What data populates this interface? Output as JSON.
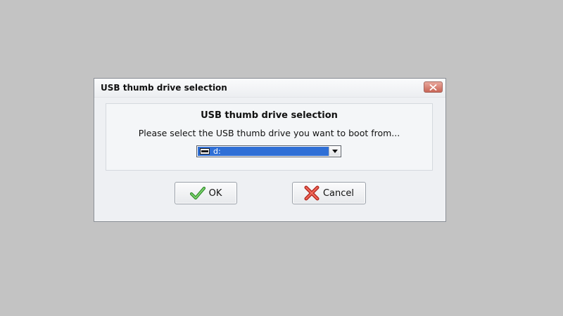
{
  "dialog": {
    "title": "USB thumb drive selection",
    "close_icon": "close-icon"
  },
  "panel": {
    "heading": "USB thumb drive selection",
    "message": "Please select the USB thumb drive you want to boot from...",
    "drive_select": {
      "selected_value": "d:",
      "icon": "drive-icon"
    }
  },
  "buttons": {
    "ok": {
      "label": "OK",
      "icon": "checkmark-icon"
    },
    "cancel": {
      "label": "Cancel",
      "icon": "cross-icon"
    }
  },
  "colors": {
    "background": "#c3c3c3",
    "selection": "#2f6fd6",
    "close_button": "#c86556",
    "ok_icon": "#3fa33a",
    "cancel_icon": "#d8362b"
  }
}
